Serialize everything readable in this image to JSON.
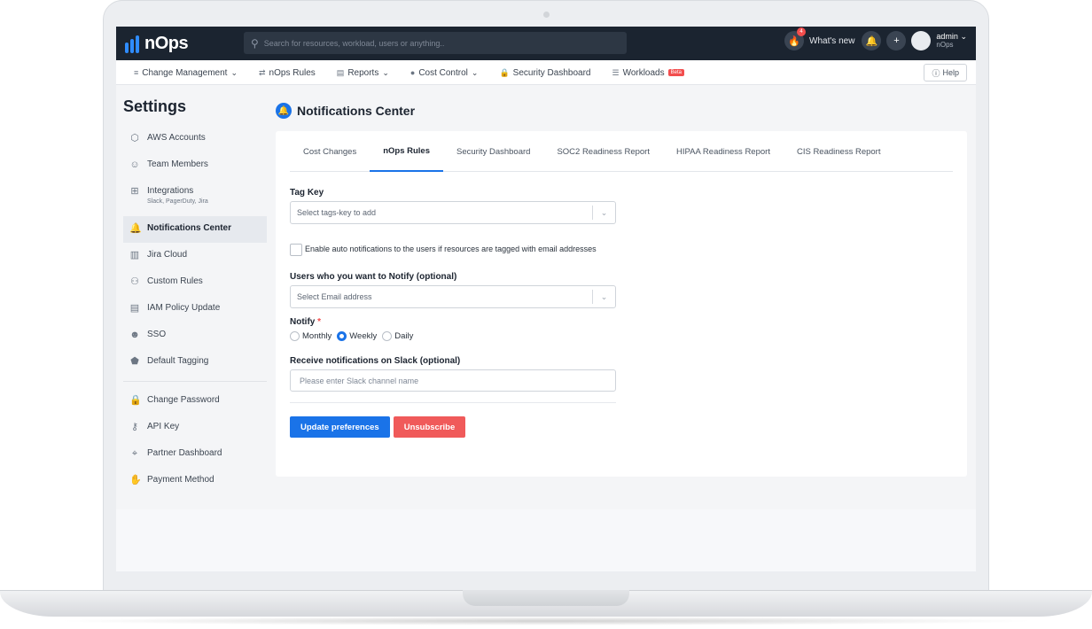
{
  "topbar": {
    "logo_text": "nOps",
    "search_placeholder": "Search for resources, workload, users or anything..",
    "notification_count": "4",
    "whats_new": "What's new",
    "user_name": "admin",
    "user_org": "nOps"
  },
  "nav": {
    "items": [
      {
        "label": "Change Management",
        "icon": "list-icon",
        "has_dropdown": true
      },
      {
        "label": "nOps Rules",
        "icon": "arrows-icon",
        "has_dropdown": false
      },
      {
        "label": "Reports",
        "icon": "document-icon",
        "has_dropdown": true
      },
      {
        "label": "Cost Control",
        "icon": "circle-icon",
        "has_dropdown": true
      },
      {
        "label": "Security Dashboard",
        "icon": "lock-icon",
        "has_dropdown": false
      },
      {
        "label": "Workloads",
        "icon": "stack-icon",
        "has_dropdown": false,
        "badge": "Beta"
      }
    ],
    "help": "Help"
  },
  "sidebar": {
    "title": "Settings",
    "items": [
      {
        "label": "AWS Accounts",
        "icon": "cube-icon"
      },
      {
        "label": "Team Members",
        "icon": "users-icon"
      },
      {
        "label": "Integrations",
        "sub": "Slack, PagerDuty, Jira",
        "icon": "grid-icon"
      },
      {
        "label": "Notifications Center",
        "icon": "bell-icon",
        "active": true
      },
      {
        "label": "Jira Cloud",
        "icon": "columns-icon"
      },
      {
        "label": "Custom Rules",
        "icon": "database-icon"
      },
      {
        "label": "IAM Policy Update",
        "icon": "file-icon"
      },
      {
        "label": "SSO",
        "icon": "people-icon"
      },
      {
        "label": "Default Tagging",
        "icon": "tag-icon"
      }
    ],
    "items2": [
      {
        "label": "Change Password",
        "icon": "padlock-icon"
      },
      {
        "label": "API Key",
        "icon": "key-icon"
      },
      {
        "label": "Partner Dashboard",
        "icon": "handshake-icon"
      },
      {
        "label": "Payment Method",
        "icon": "hand-money-icon"
      }
    ]
  },
  "main": {
    "title": "Notifications Center",
    "tabs": [
      {
        "label": "Cost Changes"
      },
      {
        "label": "nOps Rules",
        "active": true
      },
      {
        "label": "Security Dashboard"
      },
      {
        "label": "SOC2 Readiness Report"
      },
      {
        "label": "HIPAA Readiness Report"
      },
      {
        "label": "CIS Readiness Report"
      }
    ],
    "form": {
      "tag_key_label": "Tag Key",
      "tag_key_placeholder": "Select tags-key to add",
      "auto_notify_label": "Enable auto notifications to the users if resources are tagged with email addresses",
      "auto_notify_checked": false,
      "users_label": "Users who you want to Notify (optional)",
      "users_placeholder": "Select Email address",
      "notify_label": "Notify",
      "notify_required_mark": "*",
      "notify_options": [
        "Monthly",
        "Weekly",
        "Daily"
      ],
      "notify_selected": "Weekly",
      "slack_label": "Receive notifications on Slack (optional)",
      "slack_placeholder": "Please enter Slack channel name",
      "update_button": "Update preferences",
      "unsubscribe_button": "Unsubscribe"
    }
  },
  "colors": {
    "topbar_bg": "#1b2430",
    "accent": "#1a73e8",
    "danger": "#f05a5a",
    "logo_blue": "#2f8cff"
  }
}
